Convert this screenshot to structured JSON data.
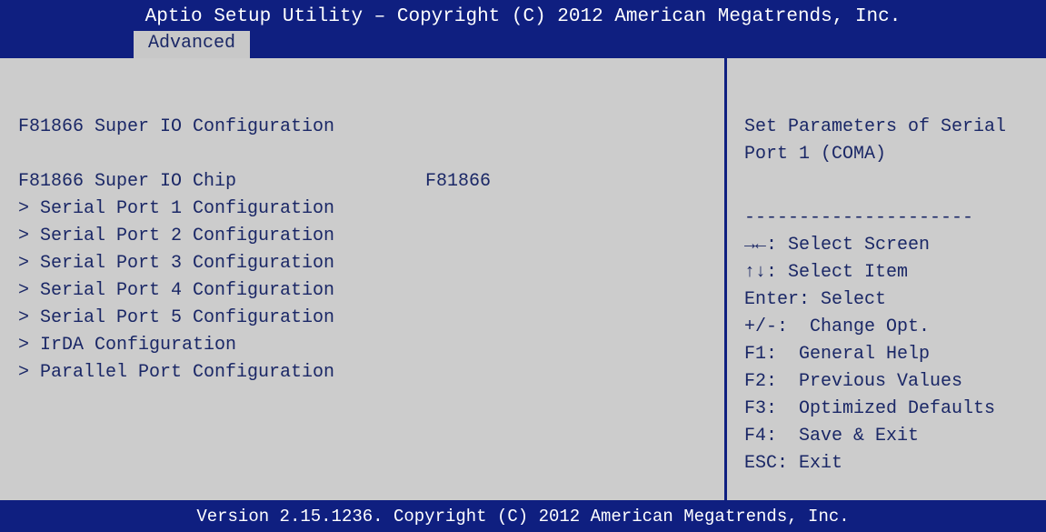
{
  "header": {
    "title": "Aptio Setup Utility – Copyright (C) 2012 American Megatrends, Inc.",
    "active_tab": "Advanced"
  },
  "main": {
    "section_title": "F81866 Super IO Configuration",
    "chip_label": "F81866 Super IO Chip",
    "chip_value": "F81866",
    "menu_items": [
      "> Serial Port 1 Configuration",
      "> Serial Port 2 Configuration",
      "> Serial Port 3 Configuration",
      "> Serial Port 4 Configuration",
      "> Serial Port 5 Configuration",
      "> IrDA Configuration",
      "> Parallel Port Configuration"
    ]
  },
  "help": {
    "description_line1": "Set Parameters of Serial",
    "description_line2": "Port 1 (COMA)",
    "separator": "---------------------",
    "keys": [
      {
        "key": "→←",
        "desc": ": Select Screen"
      },
      {
        "key": "↑↓",
        "desc": ": Select Item"
      },
      {
        "key": "Enter",
        "desc": ": Select"
      },
      {
        "key": "+/-",
        "desc": ":  Change Opt."
      },
      {
        "key": "F1",
        "desc": ":  General Help"
      },
      {
        "key": "F2",
        "desc": ":  Previous Values"
      },
      {
        "key": "F3",
        "desc": ":  Optimized Defaults"
      },
      {
        "key": "F4",
        "desc": ":  Save & Exit"
      },
      {
        "key": "ESC",
        "desc": ": Exit"
      }
    ]
  },
  "footer": {
    "version": "Version 2.15.1236. Copyright (C) 2012 American Megatrends, Inc."
  },
  "colors": {
    "header_blue": "#0f1f80",
    "panel_gray": "#cccccc",
    "text_navy": "#1a2766"
  }
}
